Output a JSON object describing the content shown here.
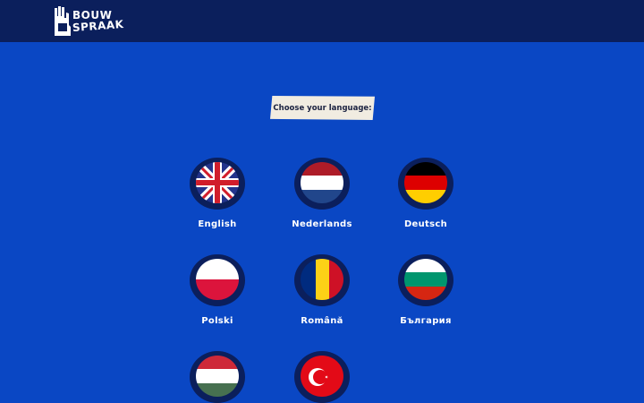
{
  "header": {
    "logo_line1": "BOUW",
    "logo_line2": "SPRAAK"
  },
  "prompt": "Choose your language:",
  "languages": [
    {
      "label": "English",
      "flag": "united-kingdom-flag-icon"
    },
    {
      "label": "Nederlands",
      "flag": "netherlands-flag-icon"
    },
    {
      "label": "Deutsch",
      "flag": "germany-flag-icon"
    },
    {
      "label": "Polski",
      "flag": "poland-flag-icon"
    },
    {
      "label": "Română",
      "flag": "romania-flag-icon"
    },
    {
      "label": "България",
      "flag": "bulgaria-flag-icon"
    },
    {
      "label": "",
      "flag": "hungary-flag-icon"
    },
    {
      "label": "",
      "flag": "turkey-flag-icon"
    }
  ],
  "colors": {
    "background": "#0a47c4",
    "header": "#0b1f5c",
    "flag_ring": "#0b1f5c",
    "prompt_bg": "#f1ece1"
  }
}
